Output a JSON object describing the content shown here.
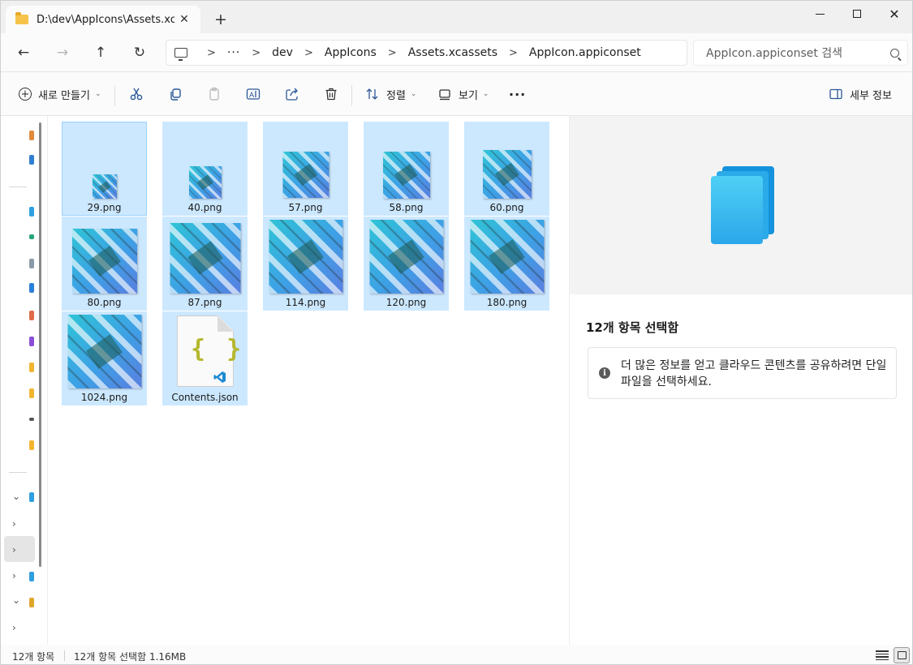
{
  "tab": {
    "title": "D:\\dev\\AppIcons\\Assets.xcassets",
    "close_glyph": "✕",
    "new_tab_glyph": "+"
  },
  "window_controls": {
    "close_glyph": "✕"
  },
  "nav": {
    "back_glyph": "←",
    "forward_glyph": "→",
    "up_glyph": "↑",
    "refresh_glyph": "↻"
  },
  "address": {
    "ellipsis": "···",
    "crumbs": [
      "dev",
      "AppIcons",
      "Assets.xcassets",
      "AppIcon.appiconset"
    ],
    "separator": ">"
  },
  "search": {
    "placeholder": "AppIcon.appiconset 검색"
  },
  "commands": {
    "new": "새로 만들기",
    "sort": "정렬",
    "view": "보기",
    "more": "···",
    "details": "세부 정보",
    "dropdown_glyph": "⌄"
  },
  "icons": {
    "cut": "scissors-icon",
    "copy": "copy-icon",
    "paste": "paste-icon",
    "rename": "rename-icon",
    "share": "share-icon",
    "delete": "trash-icon"
  },
  "files": [
    {
      "name": "29.png",
      "type": "png"
    },
    {
      "name": "40.png",
      "type": "png"
    },
    {
      "name": "57.png",
      "type": "png"
    },
    {
      "name": "58.png",
      "type": "png"
    },
    {
      "name": "60.png",
      "type": "png"
    },
    {
      "name": "80.png",
      "type": "png"
    },
    {
      "name": "87.png",
      "type": "png"
    },
    {
      "name": "114.png",
      "type": "png"
    },
    {
      "name": "120.png",
      "type": "png"
    },
    {
      "name": "180.png",
      "type": "png"
    },
    {
      "name": "1024.png",
      "type": "png"
    },
    {
      "name": "Contents.json",
      "type": "json"
    }
  ],
  "json_glyph": "{ }",
  "details_pane": {
    "title": "12개 항목 선택함",
    "info_glyph": "i",
    "info_text": "더 많은 정보를 얻고 클라우드 콘텐츠를 공유하려면 단일 파일을 선택하세요."
  },
  "status": {
    "count": "12개 항목",
    "selection": "12개 항목 선택함 1.16MB"
  },
  "colors": {
    "selection": "#cce8ff",
    "accent": "#0078d4",
    "folder": "#f7c34a"
  }
}
